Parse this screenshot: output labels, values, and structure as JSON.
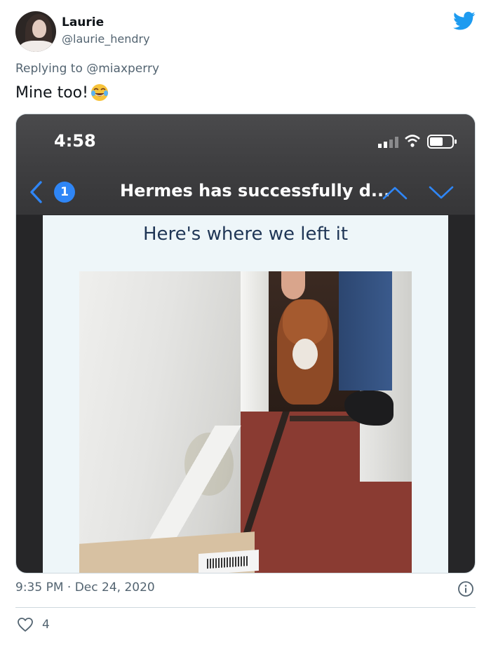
{
  "author": {
    "display_name": "Laurie",
    "handle": "@laurie_hendry",
    "avatar_icon": "profile-photo"
  },
  "brand_icon": "twitter-bird-icon",
  "brand_color": "#1d9bf0",
  "reply": {
    "prefix": "Replying to ",
    "mention": "@miaxperry"
  },
  "tweet": {
    "text": "Mine too!",
    "emoji_icon": "face-with-tears-of-joy-emoji"
  },
  "screenshot": {
    "clock": "4:58",
    "status_icons": [
      "signal-icon",
      "wifi-icon",
      "battery-icon"
    ],
    "nav": {
      "back_icon": "chevron-left-icon",
      "unread_count": "1",
      "subject": "Hermes has successfully d...",
      "prev_icon": "chevron-up-icon",
      "next_icon": "chevron-down-icon",
      "accent_color": "#2f86f6"
    },
    "email": {
      "heading": "Here's where we left it"
    }
  },
  "meta": {
    "timestamp": "9:35 PM · Dec 24, 2020",
    "info_icon": "info-icon"
  },
  "actions": {
    "like_icon": "heart-icon",
    "like_count": "4"
  }
}
